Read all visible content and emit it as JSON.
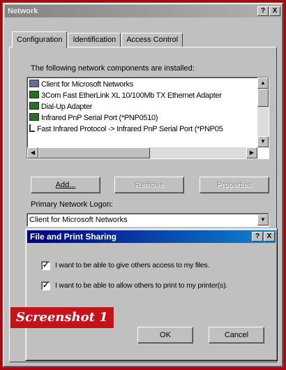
{
  "window": {
    "title": "Network",
    "title_buttons": [
      "?",
      "X"
    ]
  },
  "tabs": [
    {
      "label": "Configuration",
      "active": true
    },
    {
      "label": "Identification",
      "active": false
    },
    {
      "label": "Access Control",
      "active": false
    }
  ],
  "components_label": "The following network components are installed:",
  "components": [
    {
      "label": "Client for Microsoft Networks",
      "icon": "client-icon"
    },
    {
      "label": "3Com Fast EtherLink XL 10/100Mb TX Ethernet Adapter",
      "icon": "adapter-icon"
    },
    {
      "label": "Dial-Up Adapter",
      "icon": "adapter-icon"
    },
    {
      "label": "Infrared PnP Serial Port (*PNP0510)",
      "icon": "adapter-icon"
    },
    {
      "label": "Fast Infrared Protocol -> Infrared PnP Serial Port (*PNP05",
      "icon": "protocol-icon"
    }
  ],
  "buttons": {
    "add": "Add...",
    "remove": "Remove",
    "properties": "Properties"
  },
  "logon": {
    "label": "Primary Network Logon:",
    "value": "Client for Microsoft Networks"
  },
  "dialog": {
    "title": "File and Print Sharing",
    "title_buttons": [
      "?",
      "X"
    ],
    "options": [
      {
        "label": "I want to be able to give others access to my files.",
        "checked": true
      },
      {
        "label": "I want to be able to allow others to print to my printer(s).",
        "checked": true
      }
    ],
    "ok": "OK",
    "cancel": "Cancel"
  },
  "caption": "Screenshot 1",
  "colors": {
    "frame": "#c4131b",
    "dialog_title": "#000080"
  }
}
